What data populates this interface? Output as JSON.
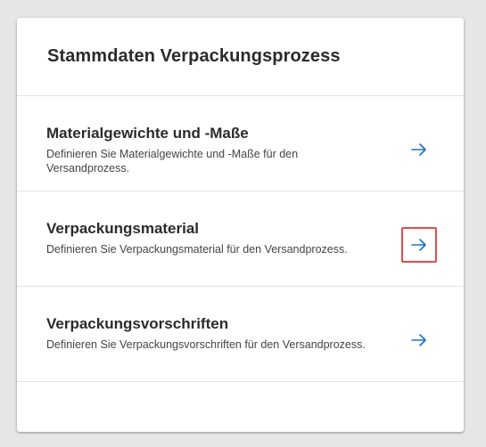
{
  "card": {
    "title": "Stammdaten Verpackungsprozess"
  },
  "items": [
    {
      "title": "Materialgewichte und -Maße",
      "description": "Definieren Sie Materialgewichte und -Maße für den Versandprozess.",
      "icon": "arrow-right-icon",
      "highlighted": false
    },
    {
      "title": "Verpackungsmaterial",
      "description": "Definieren Sie Verpackungsmaterial für den Versandprozess.",
      "icon": "arrow-right-icon",
      "highlighted": true
    },
    {
      "title": "Verpackungsvorschriften",
      "description": "Definieren Sie Verpackungsvorschriften für den Versandprozess.",
      "icon": "arrow-right-icon",
      "highlighted": false
    }
  ],
  "colors": {
    "accent": "#1a73c8",
    "highlight": "#e74c4c"
  }
}
